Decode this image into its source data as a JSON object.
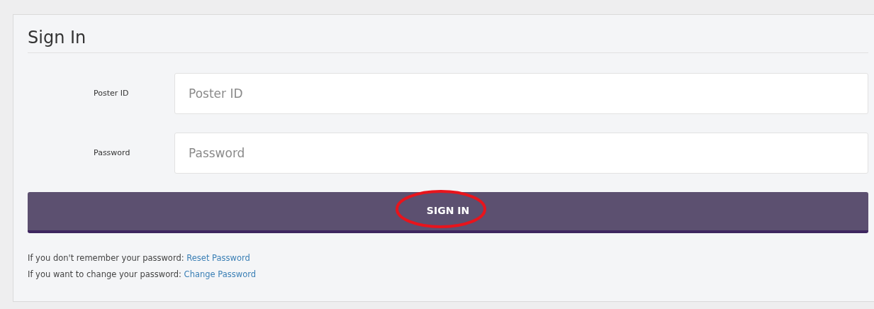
{
  "title": "Sign In",
  "fields": [
    {
      "label": "Poster ID",
      "placeholder": "Poster ID"
    },
    {
      "label": "Password",
      "placeholder": "Password"
    }
  ],
  "button": {
    "label": "SIGN IN"
  },
  "annotation": {
    "kind": "ellipse",
    "color": "#e8141c"
  },
  "help": [
    {
      "text": "If you don't remember your password:",
      "link": "Reset Password"
    },
    {
      "text": "If you want to change your password:",
      "link": "Change Password"
    }
  ]
}
